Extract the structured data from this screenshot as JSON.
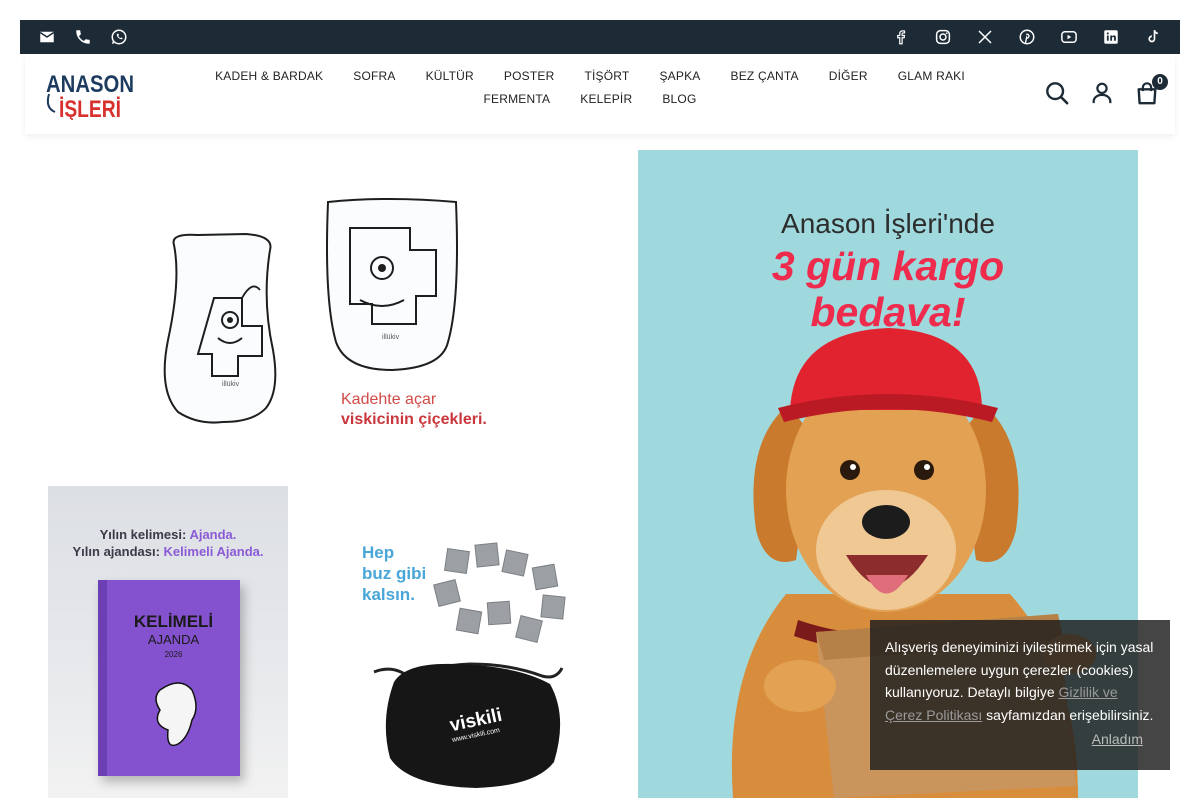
{
  "topbar": {
    "contact_icons": [
      "mail-icon",
      "phone-icon",
      "whatsapp-icon"
    ],
    "social_icons": [
      "facebook-icon",
      "instagram-icon",
      "x-icon",
      "pinterest-icon",
      "youtube-icon",
      "linkedin-icon",
      "tiktok-icon"
    ]
  },
  "logo": {
    "line1": "ANASON",
    "line2": "İŞLERİ"
  },
  "nav": {
    "items": [
      "KADEH & BARDAK",
      "SOFRA",
      "KÜLTÜR",
      "POSTER",
      "TİŞÖRT",
      "ŞAPKA",
      "BEZ ÇANTA",
      "DİĞER",
      "GLAM RAKI",
      "FERMENTA",
      "KELEPİR",
      "BLOG"
    ]
  },
  "header_icons": {
    "search": "search-icon",
    "account": "user-icon",
    "cart": "bag-icon",
    "cart_count": "0"
  },
  "banners": {
    "glasses": {
      "caption_line1": "Kadehte açar",
      "caption_line2": "viskicinin çiçekleri.",
      "glass_brand": "illükiv"
    },
    "agenda": {
      "line1_plain": "Yılın kelimesi: ",
      "line1_hl": "Ajanda.",
      "line2_plain": "Yılın ajandası: ",
      "line2_hl": "Kelimeli Ajanda.",
      "book_title": "KELİMELİ",
      "book_subtitle": "AJANDA",
      "book_year": "2026"
    },
    "stones": {
      "line1": "Hep",
      "line2": "buz gibi",
      "line3": "kalsın.",
      "bag_brand": "viskili",
      "bag_url": "www.viskili.com"
    },
    "cargo": {
      "line1": "Anason İşleri'nde",
      "line2": "3 gün kargo",
      "line3": "bedava!"
    }
  },
  "cookie": {
    "text_before": "Alışveriş deneyiminizi iyileştirmek için yasal düzenlemelere uygun çerezler (cookies) kullanıyoruz. Detaylı bilgiye ",
    "link": "Gizlilik ve Çerez Politikası",
    "text_after": " sayfamızdan erişebilirsiniz.",
    "accept": "Anladım"
  },
  "colors": {
    "topbar": "#1d2b36",
    "accent_red": "#ee2b4c",
    "cargo_bg": "#9fd9dd",
    "logo_red": "#d8302c",
    "logo_dark": "#1d3a5f"
  }
}
